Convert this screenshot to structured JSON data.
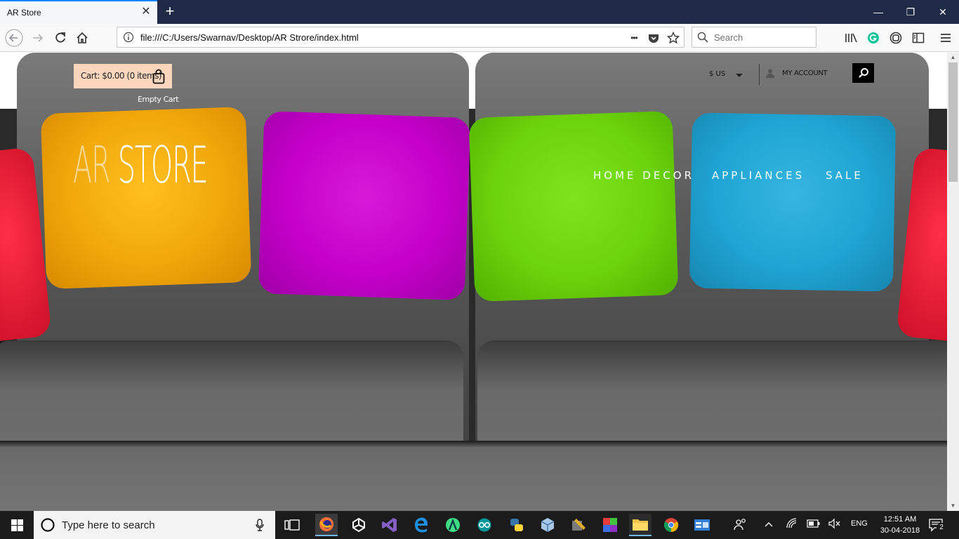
{
  "browser": {
    "tab_title": "AR Store",
    "tab_close": "✕",
    "new_tab": "+",
    "url": "file:///C:/Users/Swarnav/Desktop/AR Strore/index.html",
    "url_more": "•••",
    "search_placeholder": "Search",
    "window_controls": {
      "minimize": "—",
      "restore": "❐",
      "close": "✕"
    }
  },
  "site": {
    "cart_label": "Cart: $0.00 (0 items)",
    "empty_cart": "Empty Cart",
    "currency": "$ US",
    "account": "MY ACCOUNT",
    "logo_light": "AR ",
    "logo_bold": "STORE",
    "nav": [
      "HOME DECOR",
      "APPLIANCES",
      "SALE"
    ]
  },
  "colors": {
    "cart_bg": "#fbd6bd",
    "pillow_red": "#e0162f",
    "pillow_yellow": "#f0a70a",
    "pillow_magenta": "#c400c9",
    "pillow_green": "#6cd40c",
    "pillow_blue": "#1fa4d3",
    "tab_accent": "#0a84ff"
  },
  "taskbar": {
    "search_placeholder": "Type here to search",
    "language": "ENG",
    "time": "12:51 AM",
    "date": "30-04-2018",
    "notification_count": "2",
    "apps": [
      "firefox-icon",
      "unity-icon",
      "visual-studio-icon",
      "edge-icon",
      "android-studio-icon",
      "arduino-icon",
      "python-icon",
      "virtualbox-icon",
      "tools-icon",
      "winrar-icon",
      "file-explorer-icon",
      "chrome-icon",
      "app-window-icon"
    ]
  }
}
